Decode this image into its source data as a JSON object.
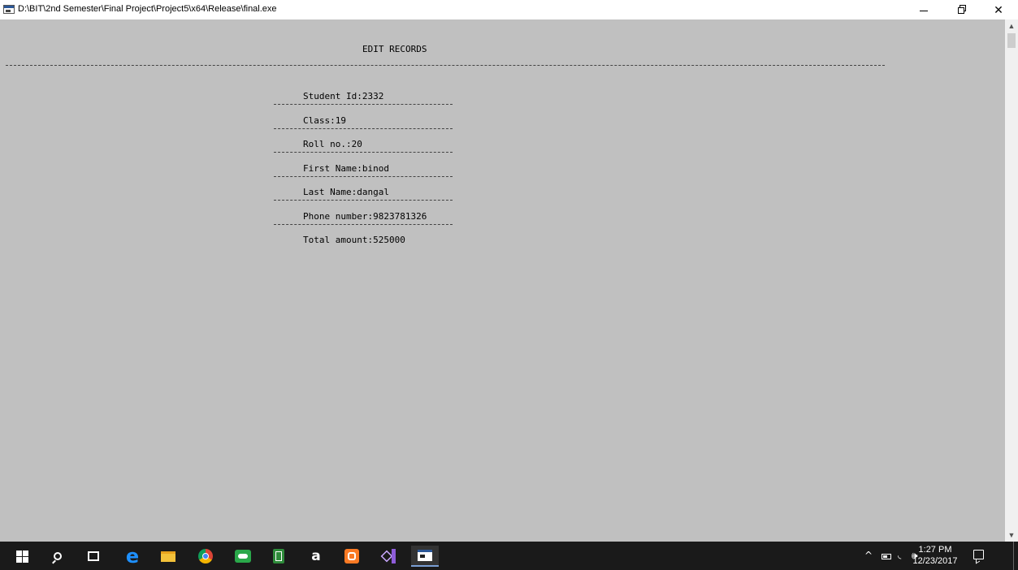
{
  "window": {
    "title": "D:\\BIT\\2nd Semester\\Final Project\\Project5\\x64\\Release\\final.exe",
    "minimize_glyph": "",
    "close_glyph": "✕"
  },
  "console": {
    "heading": "EDIT RECORDS",
    "records": [
      {
        "label": "Student Id:2332"
      },
      {
        "label": "Class:19"
      },
      {
        "label": "Roll no.:20"
      },
      {
        "label": "First Name:binod"
      },
      {
        "label": "Last Name:dangal"
      },
      {
        "label": "Phone number:9823781326"
      },
      {
        "label": "Total amount:525000"
      }
    ]
  },
  "scrollbar": {
    "up_arrow": "▲",
    "down_arrow": "▼"
  },
  "taskbar": {
    "icons": [
      "windows-start-icon",
      "search-icon",
      "task-view-icon",
      "edge-icon",
      "file-explorer-icon",
      "chrome-icon",
      "cloud-app-icon",
      "notes-app-icon",
      "amazon-icon",
      "xampp-icon",
      "visual-studio-icon",
      "console-app-icon"
    ],
    "amazon_letter": "a",
    "edge_letter": "e",
    "tray": {
      "chevron": "^",
      "wifi": "◟",
      "volume": "🕪",
      "time": "1:27 PM",
      "date": "12/23/2017"
    }
  },
  "colors": {
    "console_bg": "#c0c0c0",
    "taskbar_bg": "#1a1a1a",
    "titlebar_bg": "#ffffff"
  }
}
